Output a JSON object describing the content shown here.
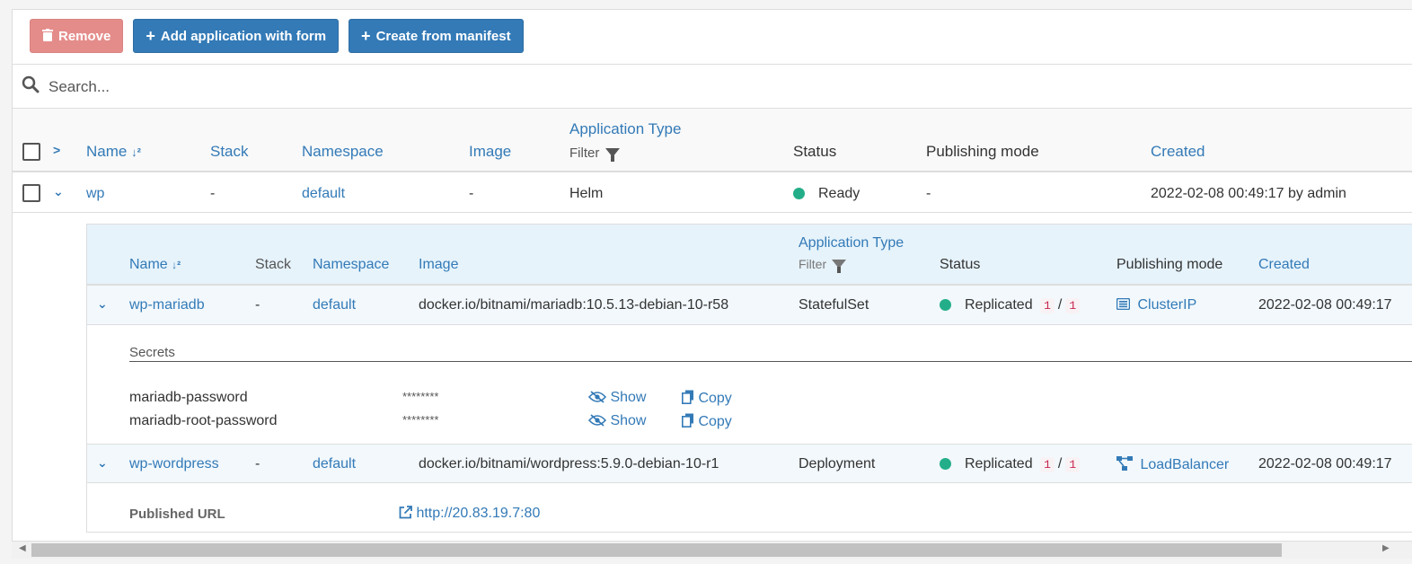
{
  "toolbar": {
    "remove_label": "Remove",
    "add_form_label": "Add application with form",
    "manifest_label": "Create from manifest"
  },
  "search": {
    "placeholder": "Search..."
  },
  "table": {
    "headers": {
      "name": "Name",
      "stack": "Stack",
      "namespace": "Namespace",
      "image": "Image",
      "app_type": "Application Type",
      "filter": "Filter",
      "status": "Status",
      "publishing": "Publishing mode",
      "created": "Created"
    },
    "row": {
      "name": "wp",
      "stack": "-",
      "namespace": "default",
      "image": "-",
      "app_type": "Helm",
      "status": "Ready",
      "publishing": "-",
      "created": "2022-02-08 00:49:17 by admin"
    }
  },
  "nested": {
    "headers": {
      "name": "Name",
      "stack": "Stack",
      "namespace": "Namespace",
      "image": "Image",
      "app_type": "Application Type",
      "filter": "Filter",
      "status": "Status",
      "publishing": "Publishing mode",
      "created": "Created"
    },
    "rows": [
      {
        "name": "wp-mariadb",
        "stack": "-",
        "namespace": "default",
        "image": "docker.io/bitnami/mariadb:10.5.13-debian-10-r58",
        "app_type": "StatefulSet",
        "status": "Replicated",
        "replicas_ready": "1",
        "replicas_slash": "/",
        "replicas_total": "1",
        "publishing": "ClusterIP",
        "created": "2022-02-08 00:49:17"
      },
      {
        "name": "wp-wordpress",
        "stack": "-",
        "namespace": "default",
        "image": "docker.io/bitnami/wordpress:5.9.0-debian-10-r1",
        "app_type": "Deployment",
        "status": "Replicated",
        "replicas_ready": "1",
        "replicas_slash": "/",
        "replicas_total": "1",
        "publishing": "LoadBalancer",
        "created": "2022-02-08 00:49:17"
      }
    ],
    "secrets": {
      "title": "Secrets",
      "items": [
        {
          "key": "mariadb-password",
          "value": "********",
          "show": "Show",
          "copy": "Copy"
        },
        {
          "key": "mariadb-root-password",
          "value": "********",
          "show": "Show",
          "copy": "Copy"
        }
      ]
    },
    "published": {
      "label": "Published URL",
      "url": "http://20.83.19.7:80"
    }
  },
  "colors": {
    "primary": "#337ab7",
    "danger": "#e48c8a",
    "success": "#23ae89",
    "badge_text": "#c7254e"
  }
}
